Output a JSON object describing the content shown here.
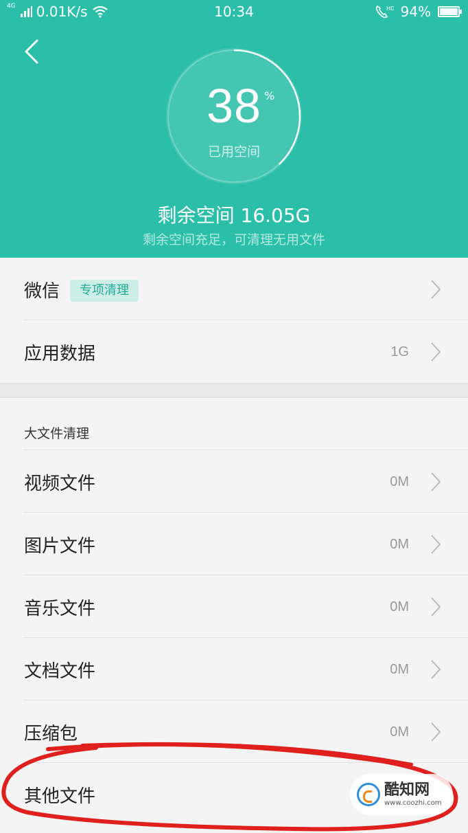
{
  "status_bar": {
    "network": "4G",
    "speed": "0.01K/s",
    "time": "10:34",
    "hd": "HD",
    "battery": "94%"
  },
  "header": {
    "percent_value": "38",
    "percent_symbol": "%",
    "ring_label": "已用空间",
    "used_fraction": 0.38,
    "remaining": "剩余空间 16.05G",
    "remaining_sub": "剩余空间充足，可清理无用文件",
    "color": "#2bbfa9"
  },
  "top_list": [
    {
      "label": "微信",
      "tag": "专项清理",
      "value": ""
    },
    {
      "label": "应用数据",
      "value": "1G"
    }
  ],
  "large_files": {
    "title": "大文件清理",
    "items": [
      {
        "label": "视频文件",
        "value": "0M"
      },
      {
        "label": "图片文件",
        "value": "0M"
      },
      {
        "label": "音乐文件",
        "value": "0M"
      },
      {
        "label": "文档文件",
        "value": "0M"
      },
      {
        "label": "压缩包",
        "value": "0M"
      },
      {
        "label": "其他文件",
        "value": ""
      }
    ]
  },
  "watermark": {
    "title": "酷知网",
    "url": "www.coozhi.com"
  }
}
